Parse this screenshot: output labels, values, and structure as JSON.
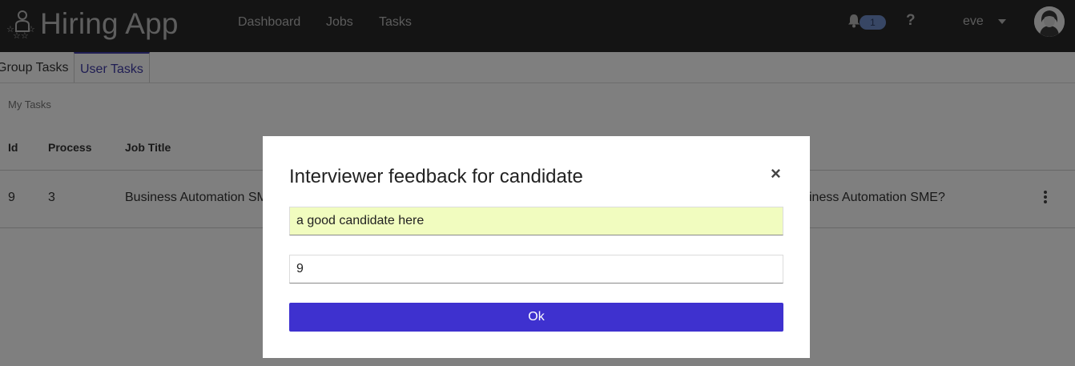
{
  "navbar": {
    "app_title": "Hiring App",
    "links": [
      "Dashboard",
      "Jobs",
      "Tasks"
    ],
    "notification_count": "1",
    "help_label": "?",
    "user_name": "eve"
  },
  "tabs": {
    "group_tasks": "Group Tasks",
    "user_tasks": "User Tasks",
    "active": "User Tasks"
  },
  "section": {
    "label": "My Tasks"
  },
  "table": {
    "headers": [
      "Id",
      "Process",
      "Job Title"
    ],
    "rows": [
      {
        "id": "9",
        "process": "3",
        "job_title": "Business Automation SM",
        "description": "siness Automation SME?"
      }
    ]
  },
  "modal": {
    "title": "Interviewer feedback for candidate",
    "close_label": "×",
    "feedback_value": "a good candidate here",
    "score_value": "9",
    "ok_label": "Ok"
  },
  "colors": {
    "navbar_bg": "#292929",
    "accent": "#3e31cf",
    "tab_active": "#3f3aa7",
    "feedback_field_bg": "#f1fcbf",
    "badge_bg": "#6f8dc9"
  }
}
